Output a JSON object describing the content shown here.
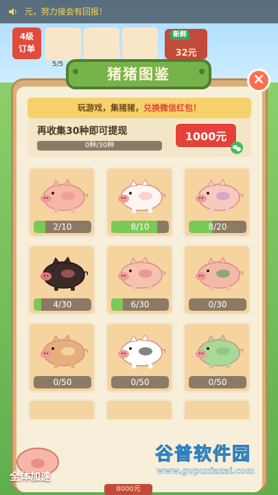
{
  "notice": {
    "text": "元，努力接会有回报！"
  },
  "orders": {
    "badge_line1": "4级",
    "badge_line2": "订单",
    "count": "5/5",
    "price": "32元",
    "new_label": "新鲜"
  },
  "modal": {
    "title": "猪猪图鉴",
    "close_symbol": "×",
    "promo_part1": "玩游戏，集猪猪，",
    "promo_part2": "兑换微信红包！",
    "collect_text": "再收集30种即可提现",
    "progress_text": "0种/30种",
    "progress_fraction": 0,
    "cash_button": "1000元"
  },
  "pigs": [
    {
      "name": "pink-pig",
      "count": "2/10",
      "fraction": 0.2,
      "body": "#f7b7a8",
      "accent": "#e98f86"
    },
    {
      "name": "white-pig",
      "count": "8/10",
      "fraction": 0.8,
      "body": "#fff6f4",
      "accent": "#f4b4b0"
    },
    {
      "name": "overalls-pig",
      "count": "8/20",
      "fraction": 0.4,
      "body": "#f7c9c0",
      "accent": "#b58ad6"
    },
    {
      "name": "black-pig",
      "count": "4/30",
      "fraction": 0.133,
      "body": "#3b2a28",
      "accent": "#e2757a"
    },
    {
      "name": "bandit-pig",
      "count": "6/30",
      "fraction": 0.2,
      "body": "#f7c1b0",
      "accent": "#e2757a"
    },
    {
      "name": "watermelon-pig",
      "count": "0/30",
      "fraction": 0,
      "body": "#f4b9a9",
      "accent": "#3e9b49"
    },
    {
      "name": "egg-pig",
      "count": "0/50",
      "fraction": 0,
      "body": "#e6b07c",
      "accent": "#fff3cf"
    },
    {
      "name": "panda-pig",
      "count": "0/50",
      "fraction": 0,
      "body": "#ffffff",
      "accent": "#1f1f1f"
    },
    {
      "name": "green-pig",
      "count": "0/50",
      "fraction": 0,
      "body": "#a8d89a",
      "accent": "#7bbf6c"
    }
  ],
  "footer": {
    "speed_label": "全体加速",
    "price": "8000元"
  },
  "watermark": {
    "brand": "谷普软件园",
    "url": "www.gupuxiazai.com"
  }
}
